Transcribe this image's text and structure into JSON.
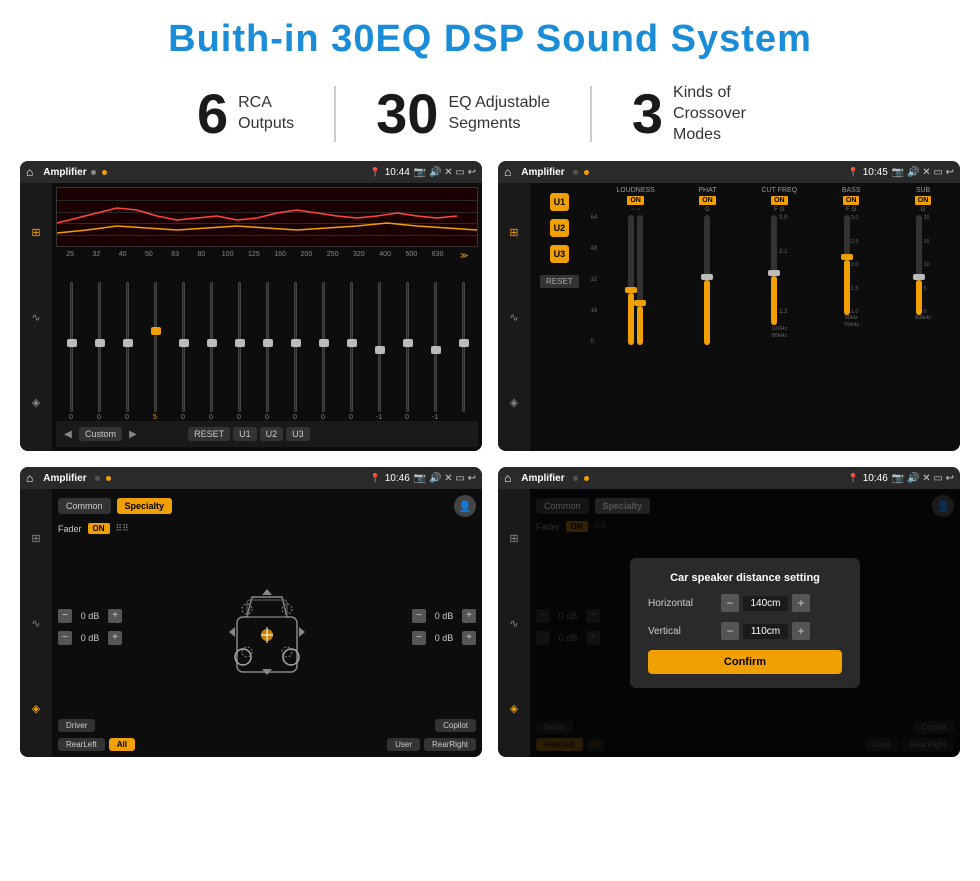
{
  "header": {
    "title": "Buith-in 30EQ DSP Sound System"
  },
  "stats": [
    {
      "number": "6",
      "label": "RCA\nOutputs"
    },
    {
      "number": "30",
      "label": "EQ Adjustable\nSegments"
    },
    {
      "number": "3",
      "label": "Kinds of\nCrossover Modes"
    }
  ],
  "screens": [
    {
      "id": "eq-screen",
      "status_bar": {
        "title": "Amplifier",
        "time": "10:44"
      }
    },
    {
      "id": "crossover-screen",
      "status_bar": {
        "title": "Amplifier",
        "time": "10:45"
      }
    },
    {
      "id": "fader-screen",
      "status_bar": {
        "title": "Amplifier",
        "time": "10:46"
      }
    },
    {
      "id": "distance-screen",
      "status_bar": {
        "title": "Amplifier",
        "time": "10:46"
      }
    }
  ],
  "eq": {
    "mode": "Custom",
    "buttons": [
      "◀",
      "Custom",
      "▶",
      "RESET",
      "U1",
      "U2",
      "U3"
    ],
    "frequencies": [
      "25",
      "32",
      "40",
      "50",
      "63",
      "80",
      "100",
      "125",
      "160",
      "200",
      "250",
      "320",
      "400",
      "500",
      "630"
    ],
    "values": [
      "0",
      "0",
      "0",
      "5",
      "0",
      "0",
      "0",
      "0",
      "0",
      "0",
      "0",
      "-1",
      "0",
      "-1"
    ]
  },
  "crossover": {
    "u_buttons": [
      "U1",
      "U2",
      "U3"
    ],
    "reset_label": "RESET",
    "channels": [
      "LOUDNESS",
      "PHAT",
      "CUT FREQ",
      "BASS",
      "SUB"
    ]
  },
  "fader": {
    "tabs": [
      "Common",
      "Specialty"
    ],
    "active_tab": "Specialty",
    "fader_label": "Fader",
    "on_label": "ON",
    "bottom_buttons": [
      "Driver",
      "RearLeft",
      "All",
      "User",
      "RearRight",
      "Copilot"
    ],
    "active_bottom": "All",
    "db_values": [
      "0 dB",
      "0 dB",
      "0 dB",
      "0 dB"
    ]
  },
  "distance": {
    "tabs": [
      "Common",
      "Specialty"
    ],
    "modal": {
      "title": "Car speaker distance setting",
      "horizontal_label": "Horizontal",
      "horizontal_value": "140cm",
      "vertical_label": "Vertical",
      "vertical_value": "110cm",
      "confirm_label": "Confirm"
    },
    "bottom_buttons": [
      "Driver",
      "RearLeft",
      "All",
      "User",
      "RearRight",
      "Copilot"
    ],
    "db_values": [
      "0 dB",
      "0 dB"
    ]
  }
}
